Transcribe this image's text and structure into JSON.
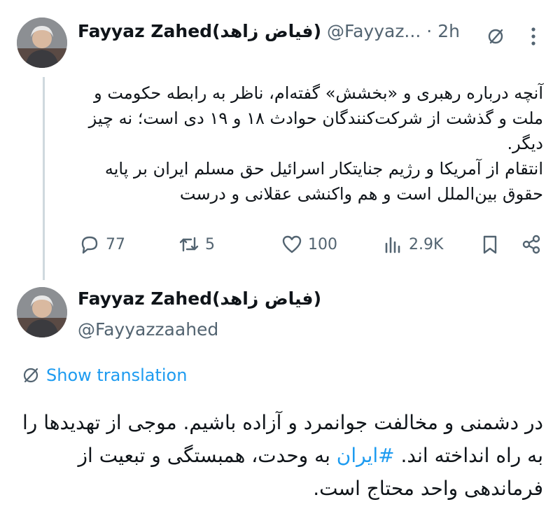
{
  "tweet1": {
    "author_name": "Fayyaz Zahed(فیاض زاهد)",
    "handle": "@Fayyaz...",
    "separator": "·",
    "time": "2h",
    "body_lines": [
      "آنچه درباره رهبری و «بخشش» گفته‌ام، ناظر به رابطه حکومت و",
      "ملت و گذشت از شرکت‌کنندگان حوادث ۱۸ و ۱۹ دی است؛ نه چیز",
      "دیگر.",
      "انتقام از آمریکا و رژیم جنایتکار اسرائیل حق مسلم ایران بر پایه",
      "حقوق بین‌الملل است و هم واکنشی عقلانی و درست"
    ],
    "actions": {
      "replies": "77",
      "reposts": "5",
      "likes": "100",
      "views": "2.9K"
    }
  },
  "tweet2": {
    "author_name": "Fayyaz Zahed(فیاض زاهد)",
    "handle": "@Fayyazzaahed",
    "show_translation": "Show translation",
    "body_line1": "در دشمنی و مخالفت جوانمرد و آزاده باشیم. موجی از تهدیدها را",
    "body_line2_before": "به راه انداخته اند. ",
    "hashtag": "#ایران",
    "body_line2_after": " به وحدت، همبستگی و تبعیت از",
    "body_line3": "فرماندهی واحد محتاج است."
  },
  "icons": {
    "grok": "grok-icon",
    "more": "more-icon",
    "reply": "reply-icon",
    "repost": "repost-icon",
    "like": "heart-icon",
    "views": "views-icon",
    "bookmark": "bookmark-icon",
    "share": "share-icon",
    "translate": "globe-slash-icon"
  },
  "colors": {
    "text": "#0f1419",
    "secondary": "#536471",
    "link": "#1d9bf0",
    "thread_line": "#cfd9de"
  }
}
